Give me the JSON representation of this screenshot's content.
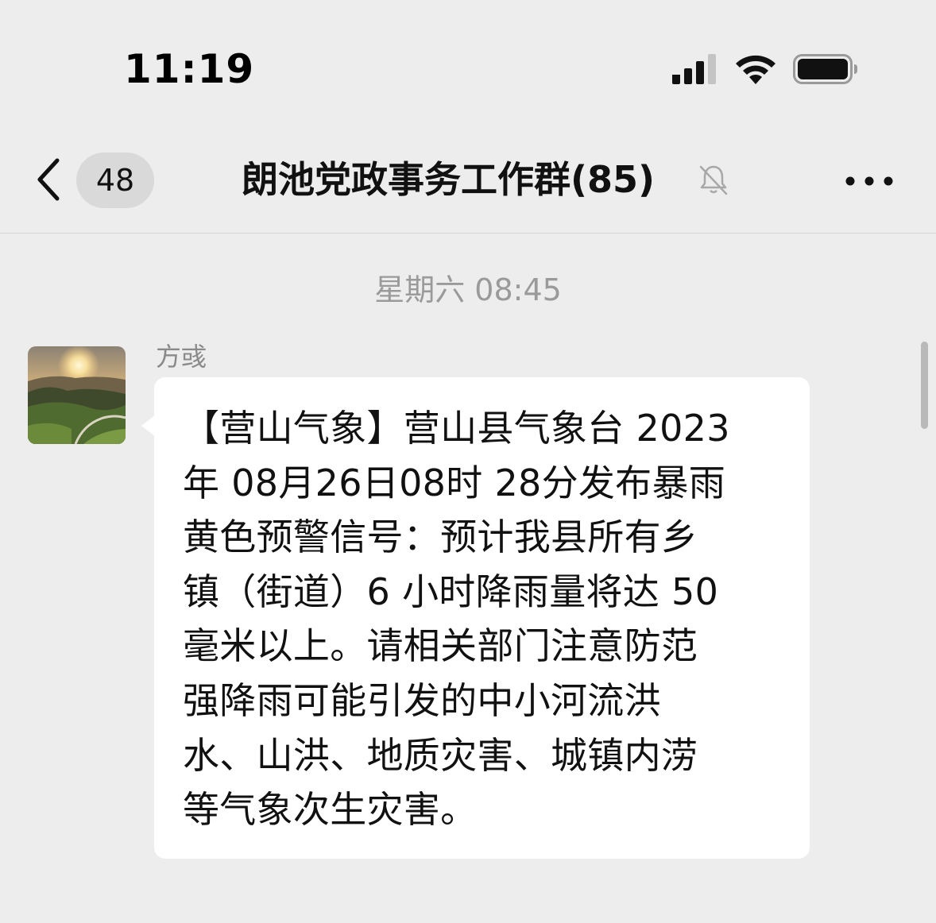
{
  "status_bar": {
    "time": "11:19",
    "signal_icon": "cellular-signal-icon",
    "wifi_icon": "wifi-icon",
    "battery_icon": "battery-icon"
  },
  "nav": {
    "back_icon": "chevron-left-icon",
    "unread_count": "48",
    "title": "朗池党政事务工作群(85)",
    "mute_icon": "bell-slash-icon",
    "more_icon": "more-dots-icon"
  },
  "chat": {
    "timestamp": "星期六 08:45",
    "messages": [
      {
        "sender": "方彧",
        "avatar": "landscape-sunset-avatar",
        "lines": [
          "【营山气象】营山县气象台 2023",
          "年 08月26日08时 28分发布暴雨",
          "黄色预警信号：预计我县所有乡",
          "镇（街道）6 小时降雨量将达 50",
          "毫米以上。请相关部门注意防范",
          "强降雨可能引发的中小河流洪",
          "水、山洪、地质灾害、城镇内涝",
          "等气象次生灾害。"
        ]
      }
    ]
  },
  "colors": {
    "background": "#ededed",
    "bubble": "#ffffff",
    "badge": "#d9d9d9",
    "muted_text": "#9a9a9a"
  }
}
